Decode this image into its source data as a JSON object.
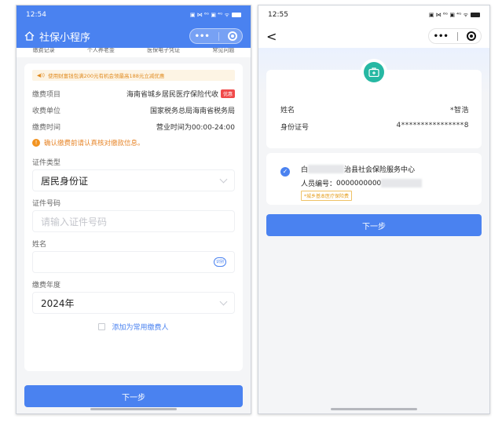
{
  "left": {
    "status": {
      "time": "12:54",
      "icons": "▣ ⋈ ⁶ᴳ ▣ ⁴ᴳ ᯤ"
    },
    "nav": {
      "title": "社保小程序",
      "more": "•••"
    },
    "tabs": [
      "缴费记录",
      "个人养老金",
      "医保电子凭证",
      "常见问题"
    ],
    "notice": "使用财富钱包满200元有机会领最高188元立减优惠",
    "info_rows": [
      {
        "label": "缴费项目",
        "value": "海南省城乡居民医疗保险代收",
        "tag": "优惠"
      },
      {
        "label": "收费单位",
        "value": "国家税务总局海南省税务局",
        "tag": ""
      },
      {
        "label": "缴费时间",
        "value": "营业时间为00:00-24:00",
        "tag": ""
      }
    ],
    "warn": "确认缴费前请认真核对缴款信息。",
    "form": {
      "id_type": {
        "label": "证件类型",
        "value": "居民身份证"
      },
      "id_number": {
        "label": "证件号码",
        "placeholder": "请输入证件号码"
      },
      "name": {
        "label": "姓名",
        "placeholder": "",
        "scan": "识别"
      },
      "year": {
        "label": "缴费年度",
        "value": "2024年"
      }
    },
    "add_payer": "添加为常用缴费人",
    "next_button": "下一步"
  },
  "right": {
    "status": {
      "time": "12:55",
      "icons": "▣ ⋈ ⁶ᴳ ▣ ⁴ᴳ ᯤ"
    },
    "nav": {
      "back": "<",
      "more": "•••"
    },
    "info_rows": [
      {
        "label": "姓名",
        "value": "*智浩"
      },
      {
        "label": "身份证号",
        "value": "4****************8"
      }
    ],
    "org": {
      "name_prefix": "白",
      "name_suffix": "治县社会保险服务中心",
      "id_label": "人员编号：",
      "id_value": "0000000000",
      "tag": "*城乡基本医疗保险费"
    },
    "next_button": "下一步"
  },
  "colors": {
    "primary": "#4a82f0",
    "warning": "#e7862a",
    "danger": "#f04a4a",
    "teal": "#26b8a3"
  }
}
